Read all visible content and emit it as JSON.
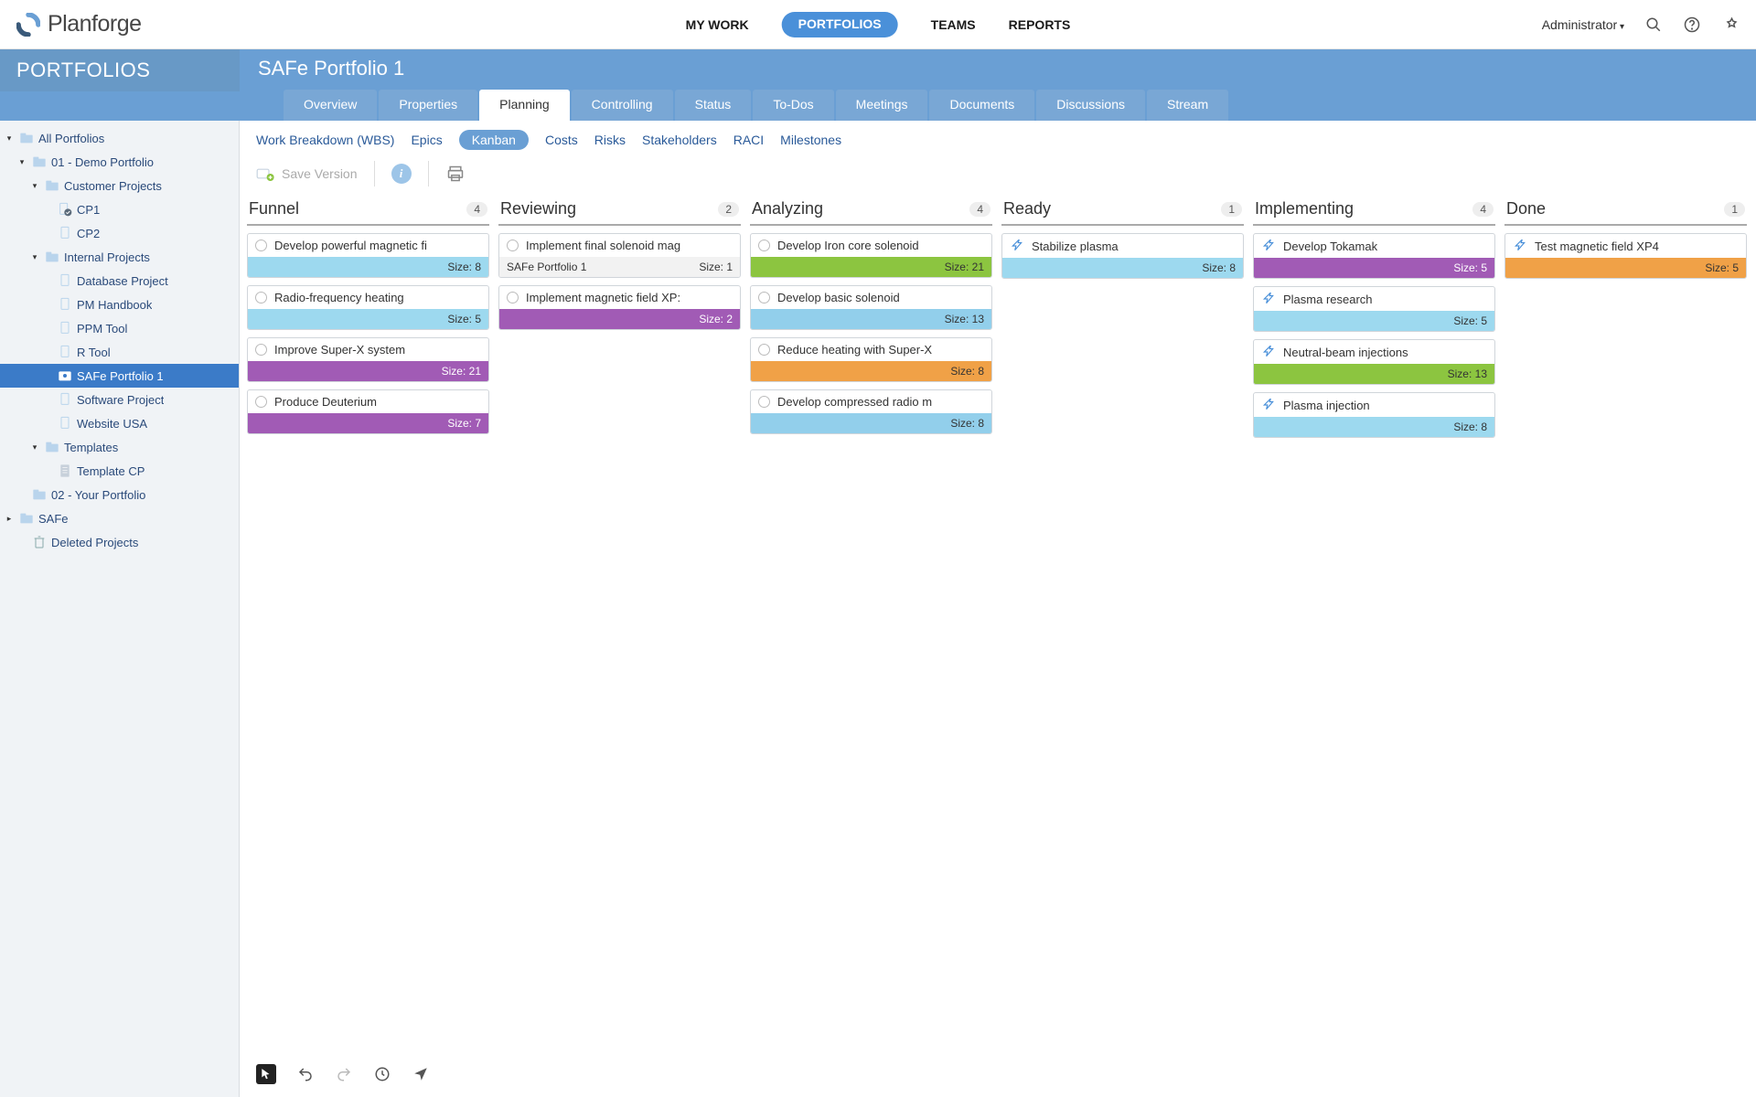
{
  "brand": "Planforge",
  "topnav": {
    "mywork": "MY WORK",
    "portfolios": "PORTFOLIOS",
    "teams": "TEAMS",
    "reports": "REPORTS"
  },
  "user": "Administrator",
  "section": "PORTFOLIOS",
  "pageTitle": "SAFe Portfolio 1",
  "subtabs": [
    "Overview",
    "Properties",
    "Planning",
    "Controlling",
    "Status",
    "To-Dos",
    "Meetings",
    "Documents",
    "Discussions",
    "Stream"
  ],
  "activeSubtab": 2,
  "innerTabs": [
    "Work Breakdown (WBS)",
    "Epics",
    "Kanban",
    "Costs",
    "Risks",
    "Stakeholders",
    "RACI",
    "Milestones"
  ],
  "activeInnerTab": 2,
  "toolbar": {
    "saveVersion": "Save Version"
  },
  "tree": [
    {
      "indent": 0,
      "toggle": "▾",
      "icon": "folder",
      "label": "All Portfolios"
    },
    {
      "indent": 1,
      "toggle": "▾",
      "icon": "folder",
      "label": "01 - Demo Portfolio"
    },
    {
      "indent": 2,
      "toggle": "▾",
      "icon": "folder",
      "label": "Customer Projects"
    },
    {
      "indent": 3,
      "toggle": "",
      "icon": "doc-check",
      "label": "CP1"
    },
    {
      "indent": 3,
      "toggle": "",
      "icon": "doc",
      "label": "CP2"
    },
    {
      "indent": 2,
      "toggle": "▾",
      "icon": "folder",
      "label": "Internal Projects"
    },
    {
      "indent": 3,
      "toggle": "",
      "icon": "doc",
      "label": "Database Project"
    },
    {
      "indent": 3,
      "toggle": "",
      "icon": "doc",
      "label": "PM Handbook"
    },
    {
      "indent": 3,
      "toggle": "",
      "icon": "doc",
      "label": "PPM Tool"
    },
    {
      "indent": 3,
      "toggle": "",
      "icon": "doc",
      "label": "R Tool"
    },
    {
      "indent": 3,
      "toggle": "",
      "icon": "safe",
      "label": "SAFe Portfolio 1",
      "selected": true
    },
    {
      "indent": 3,
      "toggle": "",
      "icon": "doc",
      "label": "Software Project"
    },
    {
      "indent": 3,
      "toggle": "",
      "icon": "doc",
      "label": "Website USA"
    },
    {
      "indent": 2,
      "toggle": "▾",
      "icon": "folder",
      "label": "Templates"
    },
    {
      "indent": 3,
      "toggle": "",
      "icon": "page",
      "label": "Template CP"
    },
    {
      "indent": 1,
      "toggle": "",
      "icon": "folder",
      "label": "02 - Your Portfolio"
    },
    {
      "indent": 0,
      "toggle": "▸",
      "icon": "folder",
      "label": "SAFe"
    },
    {
      "indent": 1,
      "toggle": "",
      "icon": "trash",
      "label": "Deleted Projects"
    }
  ],
  "sizeLabel": "Size",
  "columns": [
    {
      "title": "Funnel",
      "count": 4,
      "cards": [
        {
          "glyph": "dot",
          "title": "Develop powerful magnetic fi",
          "color": "c-cyan",
          "size": 8
        },
        {
          "glyph": "dot",
          "title": "Radio-frequency heating",
          "color": "c-cyan",
          "size": 5
        },
        {
          "glyph": "dot",
          "title": "Improve Super-X system",
          "color": "c-purple",
          "size": 21
        },
        {
          "glyph": "dot",
          "title": "Produce Deuterium",
          "color": "c-purple",
          "size": 7
        }
      ]
    },
    {
      "title": "Reviewing",
      "count": 2,
      "cards": [
        {
          "glyph": "dot",
          "title": "Implement final solenoid mag",
          "color": "c-gray",
          "size": 1,
          "sub": "SAFe Portfolio 1"
        },
        {
          "glyph": "dot",
          "title": "Implement magnetic field XP:",
          "color": "c-purple",
          "size": 2
        }
      ]
    },
    {
      "title": "Analyzing",
      "count": 4,
      "cards": [
        {
          "glyph": "dot",
          "title": "Develop Iron core solenoid",
          "color": "c-green",
          "size": 21
        },
        {
          "glyph": "dot",
          "title": "Develop basic solenoid",
          "color": "c-blue",
          "size": 13
        },
        {
          "glyph": "dot",
          "title": "Reduce heating with Super-X",
          "color": "c-orange",
          "size": 8
        },
        {
          "glyph": "dot",
          "title": "Develop compressed radio m",
          "color": "c-blue",
          "size": 8
        }
      ]
    },
    {
      "title": "Ready",
      "count": 1,
      "cards": [
        {
          "glyph": "bolt",
          "title": "Stabilize plasma",
          "color": "c-cyan",
          "size": 8
        }
      ]
    },
    {
      "title": "Implementing",
      "count": 4,
      "cards": [
        {
          "glyph": "bolt",
          "title": "Develop Tokamak",
          "color": "c-purple",
          "size": 5
        },
        {
          "glyph": "bolt",
          "title": "Plasma research",
          "color": "c-cyan",
          "size": 5
        },
        {
          "glyph": "bolt",
          "title": "Neutral-beam injections",
          "color": "c-green",
          "size": 13
        },
        {
          "glyph": "bolt",
          "title": "Plasma injection",
          "color": "c-cyan",
          "size": 8
        }
      ]
    },
    {
      "title": "Done",
      "count": 1,
      "cards": [
        {
          "glyph": "bolt",
          "title": "Test magnetic field XP4",
          "color": "c-orange",
          "size": 5
        }
      ]
    }
  ]
}
